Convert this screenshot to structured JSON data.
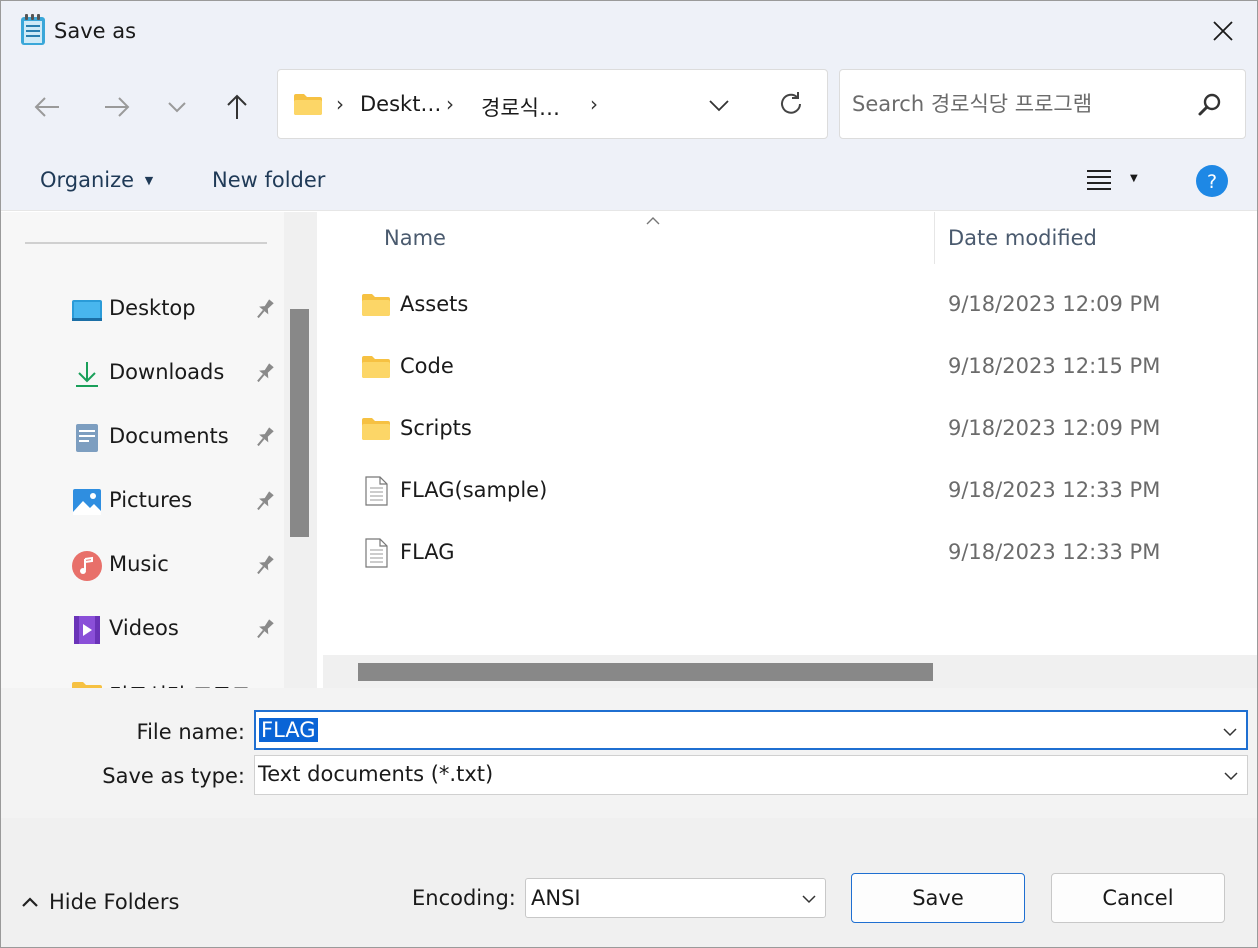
{
  "window": {
    "title": "Save as"
  },
  "address": {
    "segments": [
      "Deskt…",
      "경로식…"
    ]
  },
  "search": {
    "placeholder": "Search 경로식당 프로그램"
  },
  "toolbar": {
    "organize_label": "Organize",
    "new_folder_label": "New folder"
  },
  "sidebar": {
    "items": [
      {
        "label": "Desktop",
        "icon": "desktop-icon"
      },
      {
        "label": "Downloads",
        "icon": "downloads-icon"
      },
      {
        "label": "Documents",
        "icon": "documents-icon"
      },
      {
        "label": "Pictures",
        "icon": "pictures-icon"
      },
      {
        "label": "Music",
        "icon": "music-icon"
      },
      {
        "label": "Videos",
        "icon": "videos-icon"
      }
    ],
    "partial_item": "경로식당 프로그"
  },
  "files": {
    "columns": {
      "name": "Name",
      "date": "Date modified"
    },
    "rows": [
      {
        "name": "Assets",
        "date": "9/18/2023 12:09 PM",
        "type": "folder"
      },
      {
        "name": "Code",
        "date": "9/18/2023 12:15 PM",
        "type": "folder"
      },
      {
        "name": "Scripts",
        "date": "9/18/2023 12:09 PM",
        "type": "folder"
      },
      {
        "name": "FLAG(sample)",
        "date": "9/18/2023 12:33 PM",
        "type": "file"
      },
      {
        "name": "FLAG",
        "date": "9/18/2023 12:33 PM",
        "type": "file"
      }
    ]
  },
  "form": {
    "file_name_label": "File name:",
    "file_name_value": "FLAG",
    "save_type_label": "Save as type:",
    "save_type_value": "Text documents (*.txt)"
  },
  "footer": {
    "hide_folders_label": "Hide Folders",
    "encoding_label": "Encoding:",
    "encoding_value": "ANSI",
    "save_label": "Save",
    "cancel_label": "Cancel"
  },
  "colors": {
    "accent": "#0a64d6",
    "folder": "#f6c142",
    "help": "#1e88e5"
  }
}
